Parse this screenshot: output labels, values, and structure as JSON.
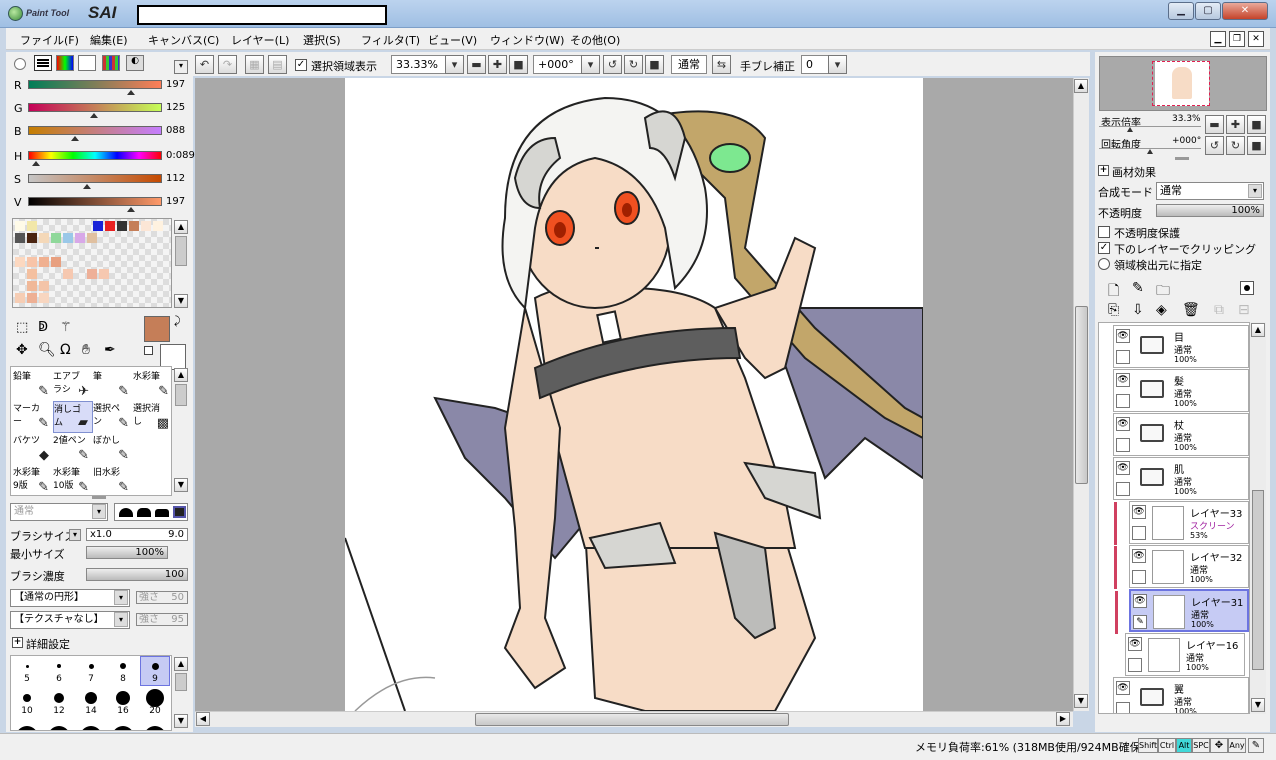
{
  "window": {
    "app_name_small": "Paint Tool",
    "app_name_big": "SAI",
    "min_label": "▁",
    "max_label": "▢",
    "close_label": "✕"
  },
  "menu": [
    "ファイル(F)",
    "編集(E)",
    "キャンバス(C)",
    "レイヤー(L)",
    "選択(S)",
    "フィルタ(T)",
    "ビュー(V)",
    "ウィンドウ(W)",
    "その他(O)"
  ],
  "toolbar": {
    "show_selection_label": "選択領域表示",
    "zoom_value": "33.33%",
    "rotation_value": "+000°",
    "blend_value": "通常",
    "stabilizer_label": "手ブレ補正",
    "stabilizer_value": "0"
  },
  "color": {
    "R": {
      "label": "R",
      "value": "197",
      "level": 0.77
    },
    "G": {
      "label": "G",
      "value": "125",
      "level": 0.49
    },
    "B": {
      "label": "B",
      "value": "088",
      "level": 0.35
    },
    "H": {
      "label": "H",
      "value": "0:089",
      "level": 0.06
    },
    "S": {
      "label": "S",
      "value": "112",
      "level": 0.44
    },
    "V": {
      "label": "V",
      "value": "197",
      "level": 0.77
    },
    "current": "#c57e58"
  },
  "tools": [
    {
      "name": "鉛筆",
      "icon": "✎"
    },
    {
      "name": "エアブラシ",
      "icon": "✈"
    },
    {
      "name": "筆",
      "icon": "✎"
    },
    {
      "name": "水彩筆",
      "icon": "✎"
    },
    {
      "name": "マーカー",
      "icon": "✎"
    },
    {
      "name": "消しゴム",
      "icon": "▰"
    },
    {
      "name": "選択ペン",
      "icon": "✎"
    },
    {
      "name": "選択消し",
      "icon": "▩"
    },
    {
      "name": "バケツ",
      "icon": "◆"
    },
    {
      "name": "2値ペン",
      "icon": "✎"
    },
    {
      "name": "ぼかし",
      "icon": "✎"
    },
    {
      "name": "",
      "icon": ""
    },
    {
      "name": "水彩筆 9版",
      "icon": "✎"
    },
    {
      "name": "水彩筆 10版",
      "icon": "✎"
    },
    {
      "name": "旧水彩",
      "icon": "✎"
    },
    {
      "name": "",
      "icon": ""
    }
  ],
  "brush": {
    "mode": "通常",
    "size_label": "ブラシサイズ",
    "size_mult": "x1.0",
    "size_value": "9.0",
    "min_size_label": "最小サイズ",
    "min_size_value": "100%",
    "density_label": "ブラシ濃度",
    "density_value": "100",
    "shape": "【通常の円形】",
    "shape_strength_label": "強さ",
    "shape_strength": "50",
    "texture": "【テクスチャなし】",
    "texture_strength_label": "強さ",
    "texture_strength": "95",
    "advanced_label": "詳細設定",
    "sizes": [
      "5",
      "6",
      "7",
      "8",
      "9",
      "10",
      "12",
      "14",
      "16",
      "20"
    ]
  },
  "navigator": {
    "zoom_label": "表示倍率",
    "zoom_value": "33.3%",
    "angle_label": "回転角度",
    "angle_value": "+000°"
  },
  "layer_props": {
    "effect_label": "画材効果",
    "blend_label": "合成モード",
    "blend_value": "通常",
    "opacity_label": "不透明度",
    "opacity_value": "100%",
    "protect_label": "不透明度保護",
    "clip_label": "下のレイヤーでクリッピング",
    "source_label": "領域検出元に指定"
  },
  "layers": [
    {
      "name": "目",
      "mode": "通常",
      "opacity": "100%",
      "type": "folder"
    },
    {
      "name": "髪",
      "mode": "通常",
      "opacity": "100%",
      "type": "folder"
    },
    {
      "name": "杖",
      "mode": "通常",
      "opacity": "100%",
      "type": "folder"
    },
    {
      "name": "肌",
      "mode": "通常",
      "opacity": "100%",
      "type": "folder-open"
    },
    {
      "name": "レイヤー33",
      "mode": "スクリーン",
      "opacity": "53%",
      "type": "sub"
    },
    {
      "name": "レイヤー32",
      "mode": "通常",
      "opacity": "100%",
      "type": "sub"
    },
    {
      "name": "レイヤー31",
      "mode": "通常",
      "opacity": "100%",
      "type": "sub-selected"
    },
    {
      "name": "レイヤー16",
      "mode": "通常",
      "opacity": "100%",
      "type": "sub2"
    },
    {
      "name": "翼",
      "mode": "通常",
      "opacity": "100%",
      "type": "folder"
    }
  ],
  "status": {
    "memory": "メモリ負荷率:61% (318MB使用/924MB確保)",
    "keys": [
      "Shift",
      "Ctrl",
      "Alt",
      "SPC",
      "",
      "Any"
    ]
  },
  "colors": {
    "accent": "#6c74e0",
    "skin": "#f7dcc6",
    "wing": "#8a88a8",
    "staff": "#c2a66a"
  }
}
